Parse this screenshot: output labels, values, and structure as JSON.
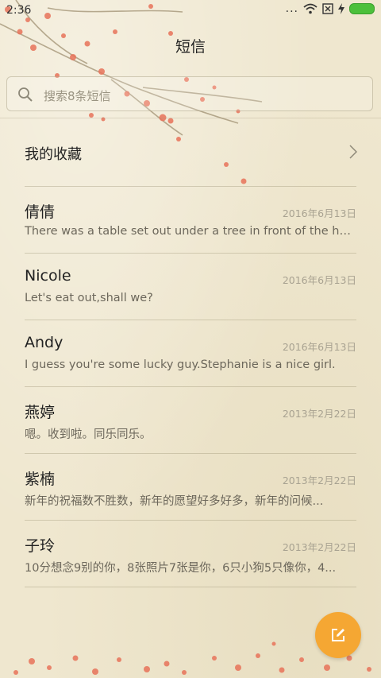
{
  "status_bar": {
    "time": "2:36",
    "more": "...",
    "icons": [
      "wifi-icon",
      "sim-off-icon",
      "charging-icon",
      "battery-icon"
    ],
    "battery_color": "#4cc03b"
  },
  "header": {
    "title": "短信"
  },
  "search": {
    "placeholder": "搜索8条短信"
  },
  "favorites": {
    "label": "我的收藏"
  },
  "messages": [
    {
      "name": "倩倩",
      "date": "2016年6月13日",
      "preview": "There was a table set out under a tree in front of the ho..."
    },
    {
      "name": "Nicole",
      "date": "2016年6月13日",
      "preview": "Let's eat out,shall we?"
    },
    {
      "name": "Andy",
      "date": "2016年6月13日",
      "preview": "I guess you're some lucky guy.Stephanie is a nice girl."
    },
    {
      "name": "燕婷",
      "date": "2013年2月22日",
      "preview": "嗯。收到啦。同乐同乐。"
    },
    {
      "name": "紫楠",
      "date": "2013年2月22日",
      "preview": "新年的祝福数不胜数，新年的愿望好多好多，新年的问候..."
    },
    {
      "name": "子玲",
      "date": "2013年2月22日",
      "preview": "10分想念9别的你，8张照片7张是你，6只小狗5只像你，4..."
    }
  ],
  "fab": {
    "icon": "compose-icon",
    "color": "#f5a733"
  }
}
